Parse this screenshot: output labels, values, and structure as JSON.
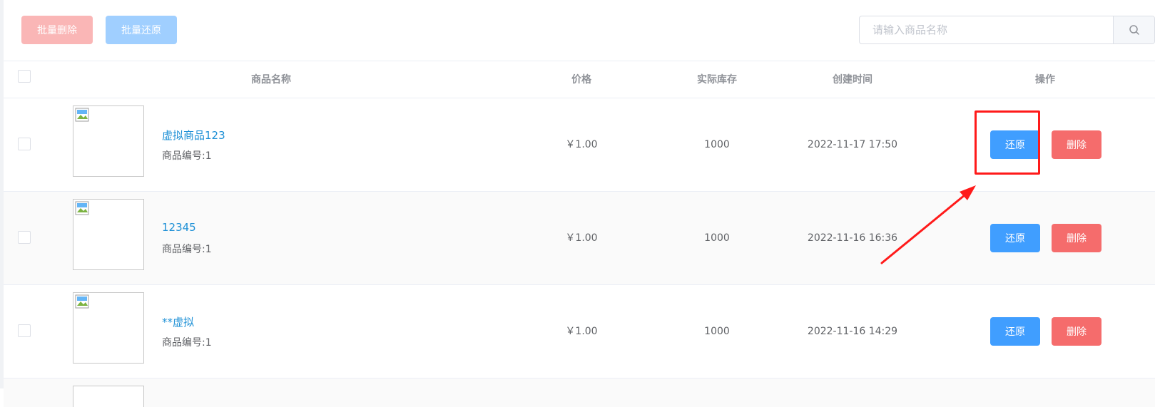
{
  "toolbar": {
    "batch_delete_label": "批量删除",
    "batch_restore_label": "批量还原"
  },
  "search": {
    "placeholder": "请输入商品名称",
    "value": ""
  },
  "table": {
    "headers": {
      "name": "商品名称",
      "price": "价格",
      "stock": "实际库存",
      "created": "创建时间",
      "actions": "操作"
    },
    "rows": [
      {
        "name": "虚拟商品123",
        "code": "商品编号:1",
        "price": "￥1.00",
        "stock": "1000",
        "created": "2022-11-17 17:50",
        "restore": "还原",
        "delete": "删除"
      },
      {
        "name": "12345",
        "code": "商品编号:1",
        "price": "￥1.00",
        "stock": "1000",
        "created": "2022-11-16 16:36",
        "restore": "还原",
        "delete": "删除"
      },
      {
        "name": "**虚拟",
        "code": "商品编号:1",
        "price": "￥1.00",
        "stock": "1000",
        "created": "2022-11-16 14:29",
        "restore": "还原",
        "delete": "删除"
      }
    ]
  },
  "colors": {
    "primary": "#409eff",
    "danger": "#f56c6c",
    "link": "#1e90d6",
    "annotation": "#ff1a1a"
  },
  "icons": {
    "search": "search-icon",
    "broken_image": "broken-image-icon"
  }
}
